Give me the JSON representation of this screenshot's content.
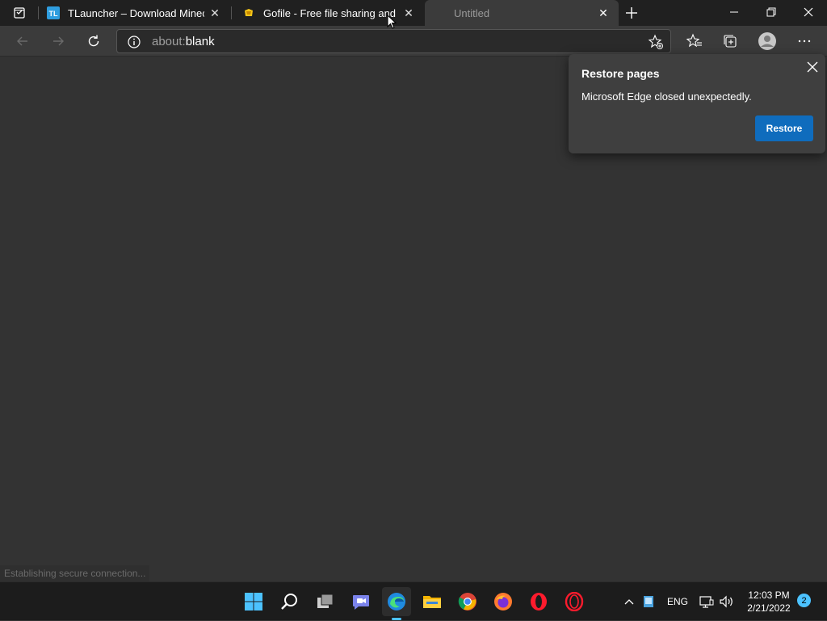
{
  "tabs": [
    {
      "title": "TLauncher – Download Minecraft",
      "favicon": "tlauncher-icon",
      "favicon_text": "TL"
    },
    {
      "title": "Gofile - Free file sharing and storage",
      "favicon": "gofile-icon"
    },
    {
      "title": "Untitled",
      "favicon": "none"
    }
  ],
  "window_controls": {
    "minimize": "minimize-icon",
    "restore": "restore-icon",
    "close": "close-icon"
  },
  "address": {
    "prefix": "about:",
    "host": "blank"
  },
  "status_text": "Establishing secure connection...",
  "popup": {
    "title": "Restore pages",
    "message": "Microsoft Edge closed unexpectedly.",
    "button": "Restore"
  },
  "taskbar": {
    "apps": [
      "start-icon",
      "search-icon",
      "task-view-icon",
      "teams-chat-icon",
      "edge-icon",
      "file-explorer-icon",
      "chrome-icon",
      "firefox-icon",
      "opera-icon",
      "opera-gx-icon"
    ],
    "language": "ENG",
    "time": "12:03 PM",
    "date": "2/21/2022",
    "notifications": "2"
  },
  "colors": {
    "accent": "#0f6cbd",
    "tray_accent": "#4cc2ff"
  }
}
